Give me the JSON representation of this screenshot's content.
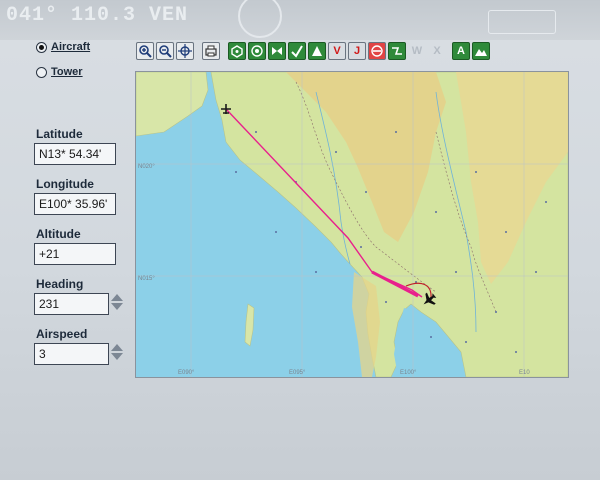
{
  "mode": {
    "aircraft_label": "Aircraft",
    "tower_label": "Tower",
    "selected": "Aircraft"
  },
  "fields": {
    "latitude": {
      "label": "Latitude",
      "value": "N13* 54.34'"
    },
    "longitude": {
      "label": "Longitude",
      "value": "E100* 35.96'"
    },
    "altitude": {
      "label": "Altitude",
      "value": "+21"
    },
    "heading": {
      "label": "Heading",
      "value": "231"
    },
    "airspeed": {
      "label": "Airspeed",
      "value": "3"
    }
  },
  "toolbar": {
    "icons": [
      "zoom-in-icon",
      "zoom-out-icon",
      "center-icon",
      "print-icon",
      "vor-icon",
      "ndb-icon",
      "ils-icon",
      "check-icon",
      "intersection-icon",
      "v-icon",
      "j-icon",
      "airport-icon",
      "route-icon",
      "w-icon",
      "x-icon",
      "label-icon",
      "terrain-icon"
    ],
    "v_label": "V",
    "j_label": "J",
    "w_label": "W",
    "x_label": "X",
    "a_label": "A"
  },
  "map": {
    "grid_labels": {
      "n020": "N020°",
      "n015": "N015°",
      "e090": "E090°",
      "e095": "E095°",
      "e100": "E100°",
      "e105": "E10"
    },
    "colors": {
      "sea": "#8cd0e8",
      "land": "#d8e6a8",
      "highland": "#e6d48a",
      "route": "#e8208c"
    }
  },
  "header": {
    "ghost_text": "041° 110.3 VEN"
  }
}
